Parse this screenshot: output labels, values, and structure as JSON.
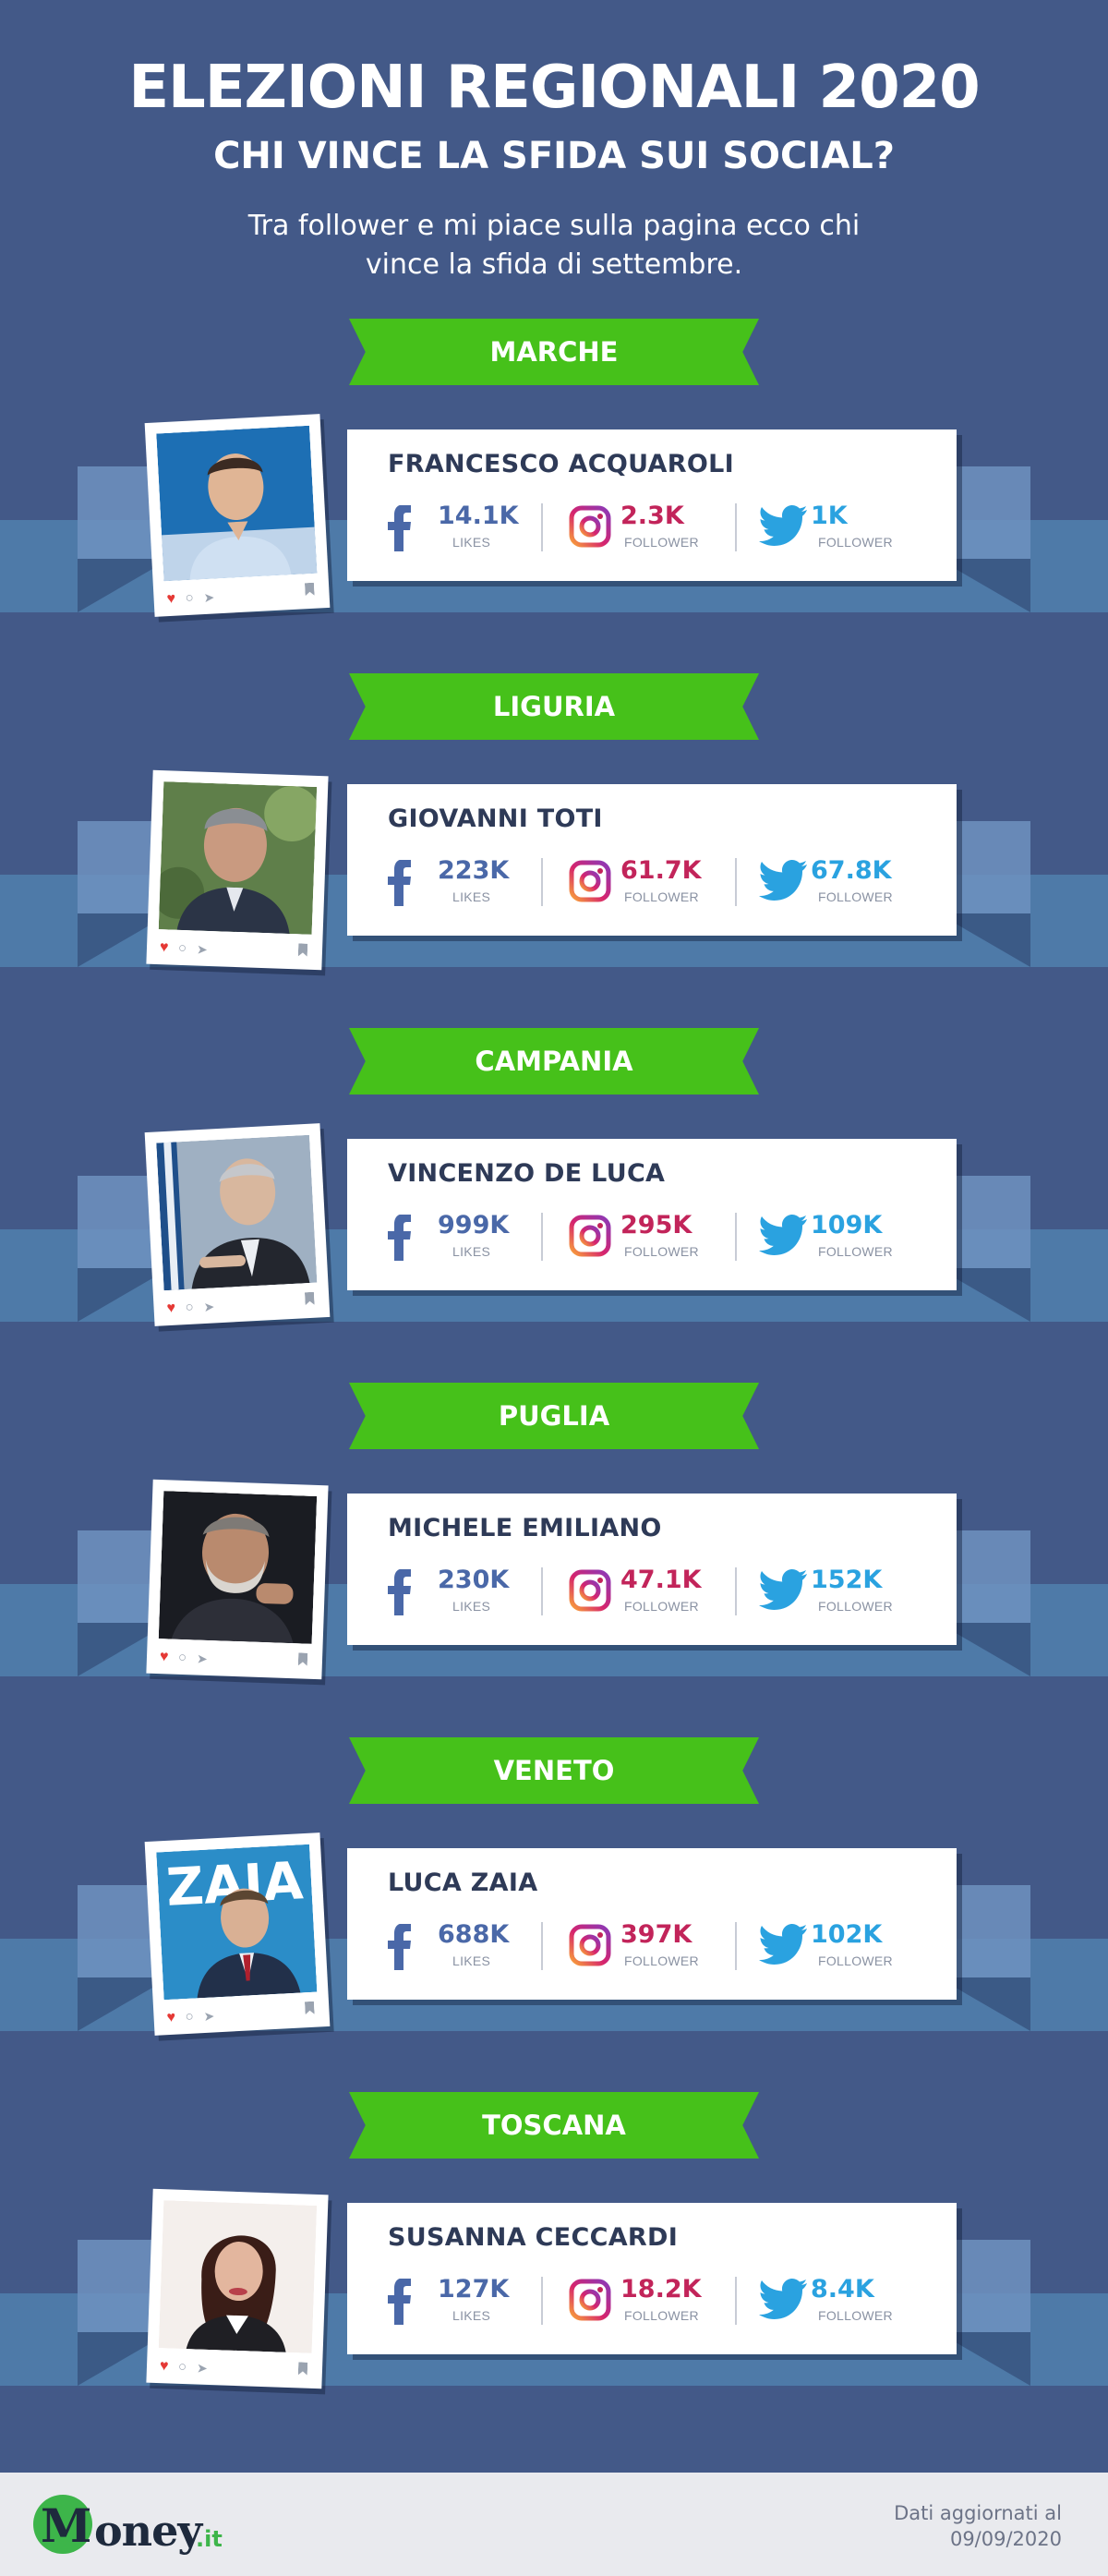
{
  "header": {
    "title": "ELEZIONI REGIONALI 2020",
    "subtitle": "CHI VINCE LA SFIDA SUI SOCIAL?",
    "intro_line1": "Tra follower e mi piace sulla pagina ecco chi",
    "intro_line2": "vince la sfida di settembre."
  },
  "colors": {
    "background": "#435988",
    "ribbon": "#46c11a",
    "facebook": "#4a68a8",
    "instagram": "#c2245a",
    "twitter": "#2aa2e0"
  },
  "icons": [
    "facebook-icon",
    "instagram-icon",
    "twitter-icon",
    "heart-icon",
    "comment-icon",
    "share-icon",
    "bookmark-icon"
  ],
  "regions": [
    {
      "region": "MARCHE",
      "name": "FRANCESCO ACQUAROLI",
      "facebook": "14.1K",
      "instagram": "2.3K",
      "twitter": "1K"
    },
    {
      "region": "LIGURIA",
      "name": "GIOVANNI TOTI",
      "facebook": "223K",
      "instagram": "61.7K",
      "twitter": "67.8K"
    },
    {
      "region": "CAMPANIA",
      "name": "VINCENZO DE LUCA",
      "facebook": "999K",
      "instagram": "295K",
      "twitter": "109K"
    },
    {
      "region": "PUGLIA",
      "name": "MICHELE EMILIANO",
      "facebook": "230K",
      "instagram": "47.1K",
      "twitter": "152K"
    },
    {
      "region": "VENETO",
      "name": "LUCA ZAIA",
      "facebook": "688K",
      "instagram": "397K",
      "twitter": "102K"
    },
    {
      "region": "TOSCANA",
      "name": "SUSANNA CECCARDI",
      "facebook": "127K",
      "instagram": "18.2K",
      "twitter": "8.4K"
    }
  ],
  "labels": {
    "likes": "LIKES",
    "follower": "FOLLOWER"
  },
  "photo_text": {
    "zaia_backdrop": "ZAIA"
  },
  "footer": {
    "logo_m": "M",
    "logo_rest": "oney",
    "logo_tld": ".it",
    "update_line1": "Dati aggiornati al",
    "update_line2": "09/09/2020"
  }
}
